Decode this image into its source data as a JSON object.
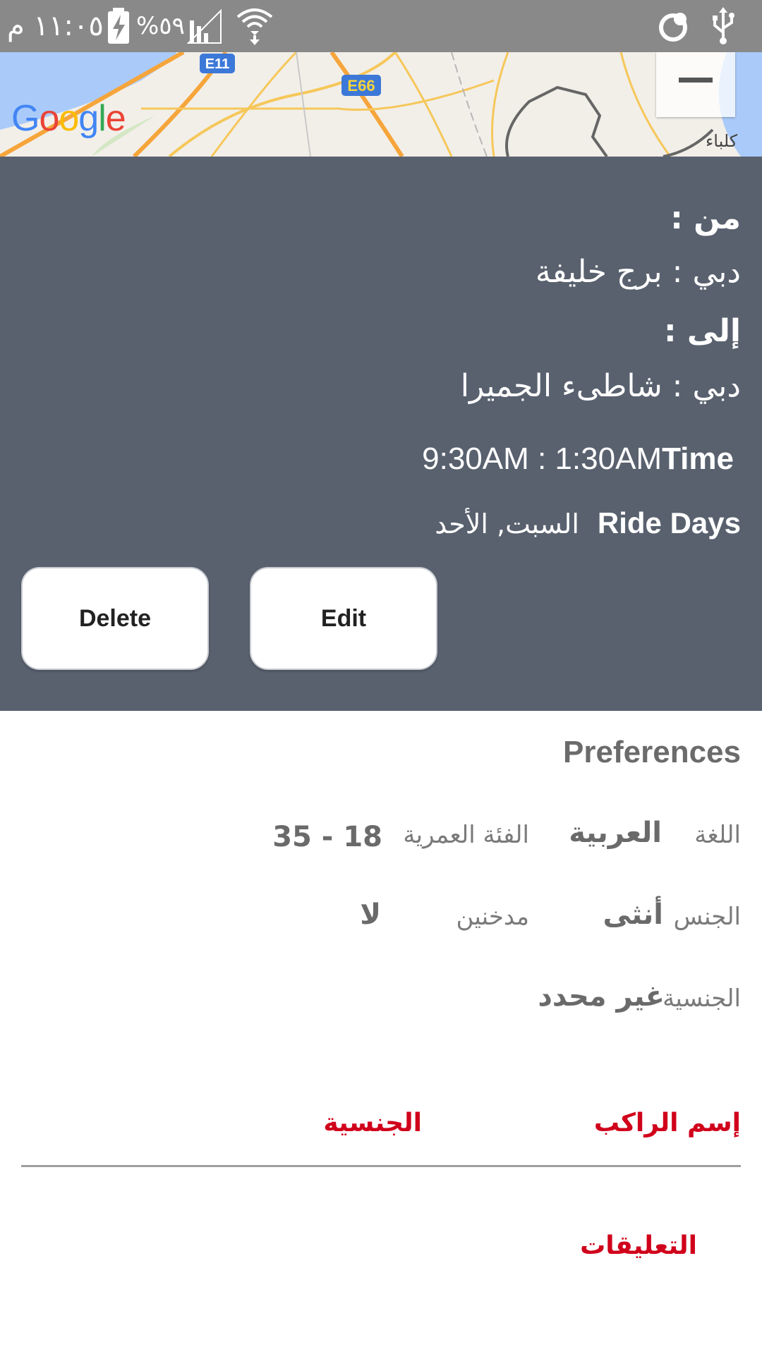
{
  "status_bar": {
    "time": "١١:٠٥ م",
    "battery_percent": "%٥٩",
    "icons": [
      "battery-charging-icon",
      "cell-signal-icon",
      "wifi-icon",
      "sync-icon",
      "usb-icon"
    ]
  },
  "map": {
    "provider_logo": "Google",
    "road_labels": [
      "E11",
      "E66"
    ],
    "zoom_label": "كلباء"
  },
  "ride": {
    "from_label": "من :",
    "from_value": "دبي : برج خليفة",
    "to_label": "إلى :",
    "to_value": "دبي : شاطىء الجميرا",
    "time_label": "Time",
    "time_value": "9:30AM :  1:30AM",
    "days_label": "Ride Days",
    "days_value": "السبت, الأحد",
    "delete_button": "Delete",
    "edit_button": "Edit"
  },
  "preferences": {
    "title": "Preferences",
    "language_label": "اللغة",
    "language_value": "العربية",
    "age_label": "الفئة العمرية",
    "age_value": "35 - 18",
    "gender_label": "الجنس",
    "gender_value": "أنثى",
    "smokers_label": "مدخنين",
    "smokers_value": "لا",
    "nationality_label": "الجنسية",
    "nationality_value": "غير محدد"
  },
  "riders_table": {
    "rider_name_header": "إسم الراكب",
    "nationality_header": "الجنسية"
  },
  "comments_label": "التعليقات",
  "colors": {
    "status_bar": "#898989",
    "panel": "#59616f",
    "accent_red": "#d0021b"
  }
}
